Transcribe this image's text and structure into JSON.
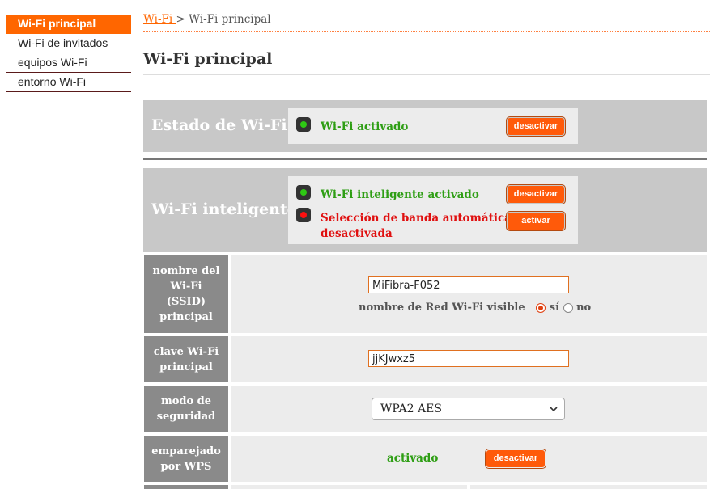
{
  "sidebar": {
    "items": [
      {
        "label": "Wi-Fi principal"
      },
      {
        "label": "Wi-Fi de invitados"
      },
      {
        "label": "equipos Wi-Fi"
      },
      {
        "label": "entorno Wi-Fi"
      }
    ]
  },
  "breadcrumb": {
    "parent": "Wi-Fi ",
    "separator": " > ",
    "current": "Wi-Fi principal"
  },
  "page_title": "Wi-Fi principal",
  "estado": {
    "title": "Estado de Wi-Fi",
    "status_text": "Wi-Fi activado",
    "button": "desactivar"
  },
  "inteligente": {
    "title": "Wi-Fi inteligente",
    "status1": "Wi-Fi inteligente activado",
    "button1": "desactivar",
    "status2_line1": "Selección de banda automática",
    "status2_line2": "desactivada",
    "button2": "activar"
  },
  "ssid": {
    "label_lines": [
      "nombre del",
      "Wi-Fi",
      "(SSID)",
      "principal"
    ],
    "value": "MiFibra-F052",
    "visible_label": "nombre de Red Wi-Fi visible",
    "opt_yes": "sí",
    "opt_no": "no"
  },
  "clave": {
    "label_lines": [
      "clave Wi-Fi",
      "principal"
    ],
    "value": "jjKJwxz5"
  },
  "modo": {
    "label_lines": [
      "modo de",
      "seguridad"
    ],
    "selected": "WPA2 AES"
  },
  "wps": {
    "label_lines": [
      "emparejado",
      "por WPS"
    ],
    "status": "activado",
    "button": "desactivar"
  },
  "colors": {
    "accent": "#ff6600",
    "green": "#2e9e14",
    "red": "#e01010",
    "panel": "#c8c8c8"
  }
}
